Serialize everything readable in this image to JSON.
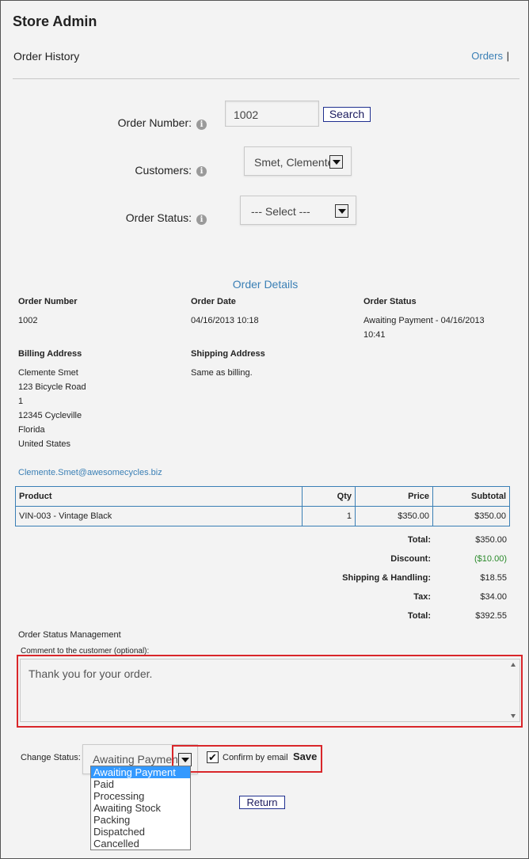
{
  "header": {
    "app_title": "Store Admin",
    "page_title": "Order History",
    "nav_orders": "Orders",
    "nav_separator": "|"
  },
  "search_form": {
    "order_number_label": "Order Number:",
    "order_number_value": "1002",
    "search_label": "Search",
    "customers_label": "Customers:",
    "customers_value": "Smet, Clemente",
    "order_status_label": "Order Status:",
    "order_status_value": "--- Select ---",
    "info_glyph": "i"
  },
  "order_details": {
    "title": "Order Details",
    "order_number_label": "Order Number",
    "order_number": "1002",
    "order_date_label": "Order Date",
    "order_date": "04/16/2013 10:18",
    "order_status_label": "Order Status",
    "order_status_line1": "Awaiting Payment - 04/16/2013",
    "order_status_line2": "10:41",
    "billing_label": "Billing Address",
    "billing_lines": [
      "Clemente Smet",
      "123 Bicycle Road",
      "1",
      "12345 Cycleville",
      "Florida",
      "United States"
    ],
    "shipping_label": "Shipping Address",
    "shipping_value": "Same as billing.",
    "email": "Clemente.Smet@awesomecycles.biz"
  },
  "products_table": {
    "headers": [
      "Product",
      "Qty",
      "Price",
      "Subtotal"
    ],
    "rows": [
      [
        "VIN-003 - Vintage Black",
        "1",
        "$350.00",
        "$350.00"
      ]
    ]
  },
  "totals": [
    {
      "label": "Total:",
      "value": "$350.00",
      "color": "#222222"
    },
    {
      "label": "Discount:",
      "value": "($10.00)",
      "color": "#2a8a2a"
    },
    {
      "label": "Shipping & Handling:",
      "value": "$18.55",
      "color": "#222222"
    },
    {
      "label": "Tax:",
      "value": "$34.00",
      "color": "#222222"
    },
    {
      "label": "Total:",
      "value": "$392.55",
      "color": "#222222"
    }
  ],
  "status_management": {
    "title": "Order Status Management",
    "comment_label": "Comment to the customer (optional):",
    "comment_value": "Thank you for your order.",
    "change_status_label": "Change Status:",
    "status_value": "Awaiting Payment",
    "status_options": [
      "Awaiting Payment",
      "Paid",
      "Processing",
      "Awaiting Stock",
      "Packing",
      "Dispatched",
      "Cancelled"
    ],
    "confirm_label": "Confirm by email",
    "confirm_check": "✔",
    "save_label": "Save",
    "return_label": "Return"
  },
  "colors": {
    "accent": "#3a7fb5",
    "highlight_border": "#d9262a",
    "selection": "#3399ff",
    "discount": "#2a8a2a"
  }
}
